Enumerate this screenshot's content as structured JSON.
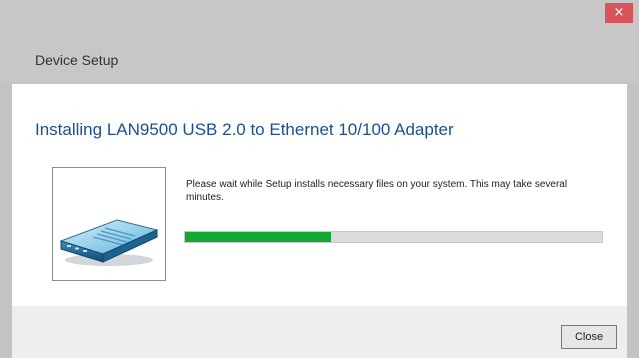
{
  "window": {
    "title": "Device Setup",
    "close_glyph": "×",
    "close_color": "#d9535a"
  },
  "main": {
    "heading": "Installing LAN9500 USB 2.0 to Ethernet 10/100 Adapter",
    "heading_color": "#1a4f96",
    "device_icon": "network-adapter-icon",
    "message": "Please wait while Setup installs necessary files on your system. This may take several minutes.",
    "progress": {
      "fraction": 0.35,
      "fill_color": "#13a834"
    }
  },
  "footer": {
    "close_label": "Close"
  }
}
